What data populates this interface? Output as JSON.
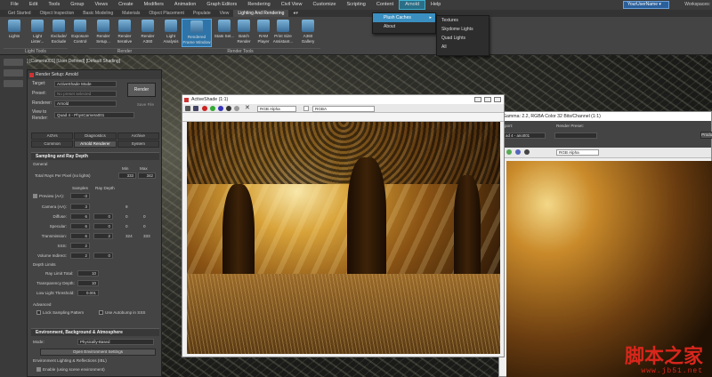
{
  "menubar": {
    "items": [
      "File",
      "Edit",
      "Tools",
      "Group",
      "Views",
      "Create",
      "Modifiers",
      "Animation",
      "Graph Editors",
      "Rendering",
      "Civil View",
      "Customize",
      "Scripting",
      "Content",
      "Arnold",
      "Help"
    ],
    "active_index": 14,
    "user": "YourUserName ▾",
    "workspaces": "Workspaces:"
  },
  "ribbon_tabs": {
    "items": [
      "Get Started",
      "Object Inspection",
      "Basic Modeling",
      "Materials",
      "Object Placement",
      "Populate",
      "View",
      "Lighting And Rendering",
      "●▾"
    ],
    "active_index": 7
  },
  "ribbon": {
    "buttons": [
      "Lights",
      "Light Lister...",
      "Exclude/ Exclude",
      "Exposure Control",
      "Render Setup...",
      "Render Iterative",
      "Render A360",
      "Light Analysis",
      "Rendered Frame Window",
      "Stats Set...",
      "Batch Render",
      "RAM Player",
      "Print Size Assistant...",
      "A360 Gallery"
    ],
    "groups": [
      "Light Tools",
      "Render",
      "Render Tools"
    ]
  },
  "arnold_menu": {
    "items": [
      "Plush Caches",
      "About"
    ],
    "submenu": [
      "Textures",
      "Skydome Lights",
      "Quad Lights",
      "All"
    ]
  },
  "viewport": {
    "label": "[+] [Camera001] [User Defined] [Default Shading]"
  },
  "render_setup": {
    "title": "Render Setup: Arnold",
    "target_label": "Target:",
    "target_value": "ActiveShade Mode",
    "preset_label": "Preset:",
    "preset_value": "No preset selected",
    "renderer_label": "Renderer:",
    "renderer_value": "Arnold",
    "view_label": "View to Render:",
    "view_value": "Quad 4 - PhysCamera001",
    "render_button": "Render",
    "save_file": "Save File",
    "tabs": [
      "AOVs",
      "Diagnostics",
      "Archive",
      "Common",
      "Arnold Renderer",
      "System"
    ],
    "active_tab": 4,
    "sampling_header": "Sampling and Ray Depth",
    "general": "General",
    "min_label": "Min",
    "max_label": "Max",
    "total_rays_label": "Total Rays Per Pixel (no lights)",
    "total_min": "333",
    "total_max": "342",
    "samples_label": "Samples",
    "raydepth_label": "Ray Depth",
    "preview_label": "Preview (AA):",
    "preview_val": "-3",
    "rows": [
      {
        "label": "Camera (AA):",
        "samples": "3",
        "depth": "",
        "min": "9",
        "max": ""
      },
      {
        "label": "Diffuse:",
        "samples": "6",
        "depth": "0",
        "min": "0",
        "max": "0"
      },
      {
        "label": "Specular:",
        "samples": "6",
        "depth": "0",
        "min": "0",
        "max": "0"
      },
      {
        "label": "Transmission:",
        "samples": "6",
        "depth": "2",
        "min": "324",
        "max": "333"
      },
      {
        "label": "SSS:",
        "samples": "2",
        "depth": "",
        "min": "",
        "max": ""
      },
      {
        "label": "Volume Indirect:",
        "samples": "2",
        "depth": "0",
        "min": "",
        "max": ""
      }
    ],
    "depth_limits": "Depth Limits",
    "ray_limit_label": "Ray Limit Total:",
    "ray_limit_val": "10",
    "transp_label": "Transparency Depth:",
    "transp_val": "10",
    "lowlight_label": "Low Light Threshold:",
    "lowlight_val": "0.001",
    "advanced": "Advanced",
    "lock_label": "Lock Sampling Pattern",
    "autobump_label": "Use Autobump in SSS",
    "env_header": "Environment, Background & Atmosphere",
    "mode_label": "Mode:",
    "mode_value": "Physically-Based",
    "open_env": "Open Environment Settings",
    "env_light": "Environment Lighting & Reflections (IBL)",
    "enable_label": "Enable (using scene environment)"
  },
  "activeshade": {
    "title": "ActiveShade (1:1)",
    "channel": "RGB Alpha",
    "mode": "RGBA"
  },
  "frame_window": {
    "title": "Gamma: 2.2, RGBA Color 32 Bits/Channel (1:1)",
    "viewport_label": "port:",
    "viewport_value": "ad 4 - ano001",
    "preset_label": "Render Preset:",
    "channel": "RGB Alpha",
    "prod": "Produ"
  },
  "watermark": {
    "big": "脚本之家",
    "small": "www.jb51.net"
  }
}
